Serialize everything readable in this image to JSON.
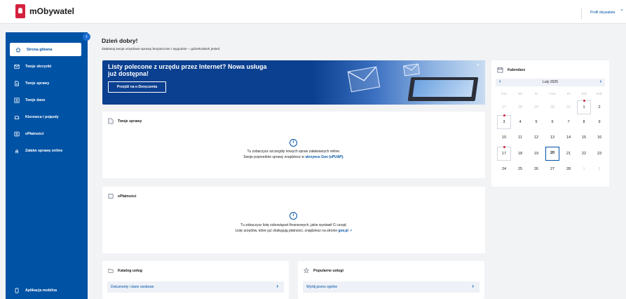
{
  "app": {
    "name": "mObywatel",
    "profile_label": "Profil obywatela"
  },
  "sidebar": {
    "items": [
      {
        "label": "Strona główna",
        "icon": "home-icon",
        "active": true
      },
      {
        "label": "Twoje skrzynki",
        "icon": "mail-icon"
      },
      {
        "label": "Twoje sprawy",
        "icon": "document-icon"
      },
      {
        "label": "Twoje dane",
        "icon": "id-card-icon"
      },
      {
        "label": "Kierowca i pojazdy",
        "icon": "car-icon"
      },
      {
        "label": "ePłatności",
        "icon": "payment-icon"
      },
      {
        "label": "Załatw sprawę online",
        "icon": "hand-icon"
      }
    ],
    "footer_label": "Aplikacja mobilna",
    "collapse_glyph": "‹"
  },
  "main": {
    "greeting": "Dzień dobry!",
    "subtitle": "Załatwiaj swoje urzędowe sprawy bezpiecznie i wygodnie – gdziekolwiek jesteś."
  },
  "banner": {
    "title": "Listy polecone z urzędu przez Internet? Nowa usługa już dostępna!",
    "button": "Przejdź na e-Doręczenia",
    "close": "×"
  },
  "cases_card": {
    "title": "Twoje sprawy",
    "line1": "Tu zobaczysz szczegóły nowych spraw załatwianych online.",
    "line2_prefix": "Swoje poprzednie sprawy znajdziesz w",
    "line2_link": "skrzynce Gov (ePUAP)."
  },
  "payments_card": {
    "title": "ePłatności",
    "line1": "Tu zobaczysz listę zobowiązań finansowych, jakie wystawił Ci urząd.",
    "line2_prefix": "Listę urzędów, które już obsługują płatności, znajdziesz na stronie",
    "line2_link": "gov.pl"
  },
  "catalog_card": {
    "title": "Katalog usług",
    "row1": "Dokumenty i dane osobowe"
  },
  "popular_card": {
    "title": "Popularne usługi",
    "row1": "Wyślij pismo ogólne"
  },
  "calendar": {
    "title": "Kalendarz",
    "month": "Luty 2025",
    "dow": [
      "Pon",
      "Wt",
      "Śr",
      "Czw",
      "Pt",
      "Sob",
      "Ndz"
    ],
    "weeks": [
      [
        "27",
        "28",
        "29",
        "30",
        "31",
        "1",
        "2"
      ],
      [
        "3",
        "4",
        "5",
        "6",
        "7",
        "8",
        "9"
      ],
      [
        "10",
        "11",
        "12",
        "13",
        "14",
        "15",
        "16"
      ],
      [
        "17",
        "18",
        "19",
        "20",
        "21",
        "22",
        "23"
      ],
      [
        "24",
        "25",
        "26",
        "27",
        "28",
        "1",
        "2"
      ]
    ],
    "today": "20",
    "colors": {
      "accent": "#0052a5",
      "dot": "#d4213d"
    }
  },
  "colors": {
    "primary": "#0052a5",
    "banner": "#0b3f8f",
    "background": "#f2f3f5"
  }
}
